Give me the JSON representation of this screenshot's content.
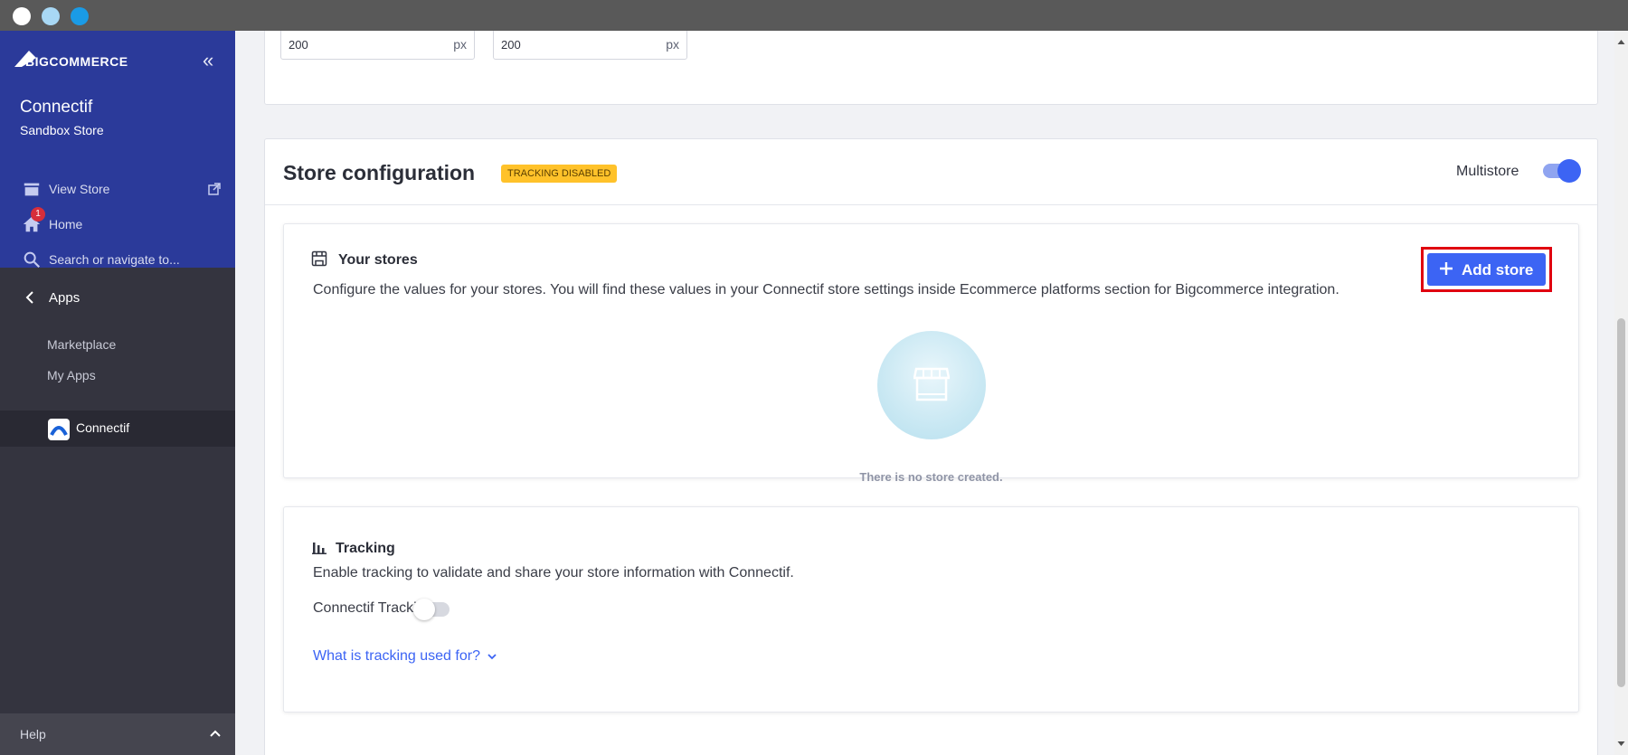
{
  "window": {
    "dot_colors": [
      "#ffffff",
      "#a8d8f5",
      "#1a9be6"
    ]
  },
  "sidebar": {
    "brand": "BIGCOMMERCE",
    "store_name": "Connectif",
    "store_subtitle": "Sandbox Store",
    "view_store_label": "View Store",
    "home_label": "Home",
    "home_badge": "1",
    "search_placeholder": "Search or navigate to...",
    "apps_label": "Apps",
    "apps_items": [
      "Marketplace",
      "My Apps"
    ],
    "active_app_label": "Connectif",
    "help_label": "Help"
  },
  "top_card": {
    "width_value": "200",
    "width_unit": "px",
    "height_value": "200",
    "height_unit": "px"
  },
  "store_config": {
    "title": "Store configuration",
    "status_tag": "TRACKING DISABLED",
    "multistore_label": "Multistore",
    "multistore_enabled": true,
    "your_stores": {
      "title": "Your stores",
      "description": "Configure the values for your stores. You will find these values in your Connectif store settings inside Ecommerce platforms section for Bigcommerce integration.",
      "add_button_label": "Add store",
      "empty_text": "There is no store created."
    },
    "tracking": {
      "title": "Tracking",
      "description": "Enable tracking to validate and share your store information with Connectif.",
      "toggle_label": "Connectif Tracking",
      "toggle_enabled": false,
      "link_text": "What is tracking used for?"
    }
  },
  "colors": {
    "sidebar_top": "#2b3a9a",
    "sidebar_bg": "#34343f",
    "primary": "#3c64f4",
    "warning_tag": "#ffc22a",
    "highlight": "#e0000f"
  }
}
